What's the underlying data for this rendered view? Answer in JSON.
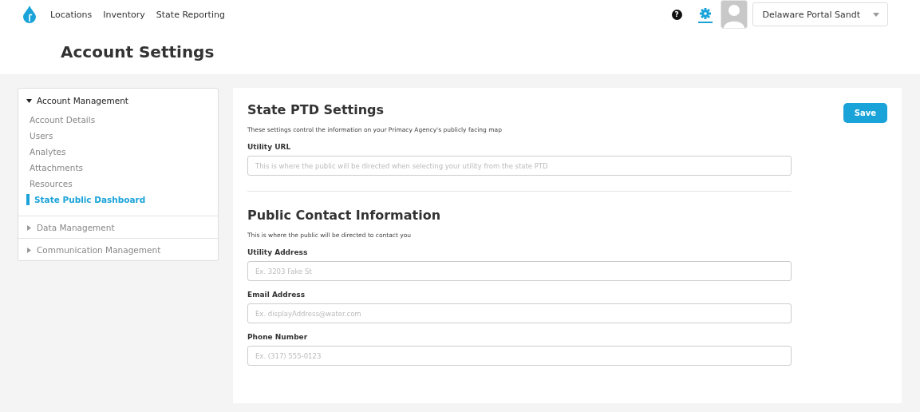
{
  "nav": {
    "links": [
      "Locations",
      "Inventory",
      "State Reporting"
    ],
    "help": "?",
    "settings_selected": true,
    "account": "Delaware Portal Sandt"
  },
  "page_title": "Account Settings",
  "sidebar": {
    "groups": [
      {
        "label": "Account Management",
        "expanded": true,
        "items": [
          {
            "label": "Account Details",
            "selected": false
          },
          {
            "label": "Users",
            "selected": false
          },
          {
            "label": "Analytes",
            "selected": false
          },
          {
            "label": "Attachments",
            "selected": false
          },
          {
            "label": "Resources",
            "selected": false
          },
          {
            "label": "State Public Dashboard",
            "selected": true
          }
        ]
      },
      {
        "label": "Data Management",
        "expanded": false
      },
      {
        "label": "Communication Management",
        "expanded": false
      }
    ]
  },
  "save_button": "Save",
  "sections": [
    {
      "title": "State PTD Settings",
      "description": "These settings control the information on your Primacy Agency's publicly facing map",
      "fields": [
        {
          "label": "Utility URL",
          "placeholder": "This is where the public will be directed when selecting your utility from the state PTD"
        }
      ]
    },
    {
      "title": "Public Contact Information",
      "description": "This is where the public will be directed to contact you",
      "fields": [
        {
          "label": "Utility Address",
          "placeholder": "Ex. 3203 Fake St"
        },
        {
          "label": "Email Address",
          "placeholder": "Ex. displayAddress@water.com"
        },
        {
          "label": "Phone Number",
          "placeholder": "Ex. (317) 555-0123"
        }
      ]
    }
  ]
}
